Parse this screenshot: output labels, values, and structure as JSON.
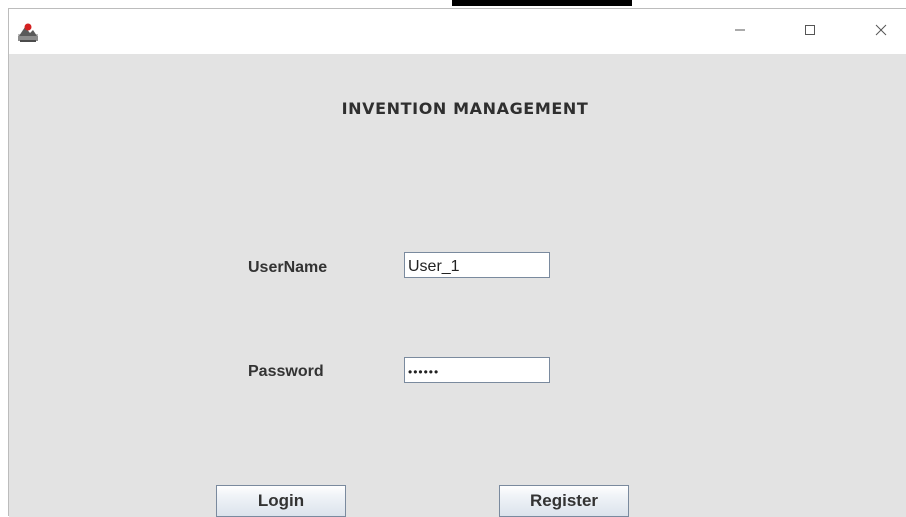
{
  "window": {
    "controls": {
      "minimize_icon": "minimize-icon",
      "maximize_icon": "maximize-icon",
      "close_icon": "close-icon"
    },
    "app_icon": "java-app-icon"
  },
  "form": {
    "title": "INVENTION MANAGEMENT",
    "username": {
      "label": "UserName",
      "value": "User_1"
    },
    "password": {
      "label": "Password",
      "value": "••••••"
    },
    "buttons": {
      "login": "Login",
      "register": "Register"
    }
  },
  "colors": {
    "content_background": "#e3e3e3",
    "field_border": "#7a8a9e",
    "label_text": "#333333"
  }
}
